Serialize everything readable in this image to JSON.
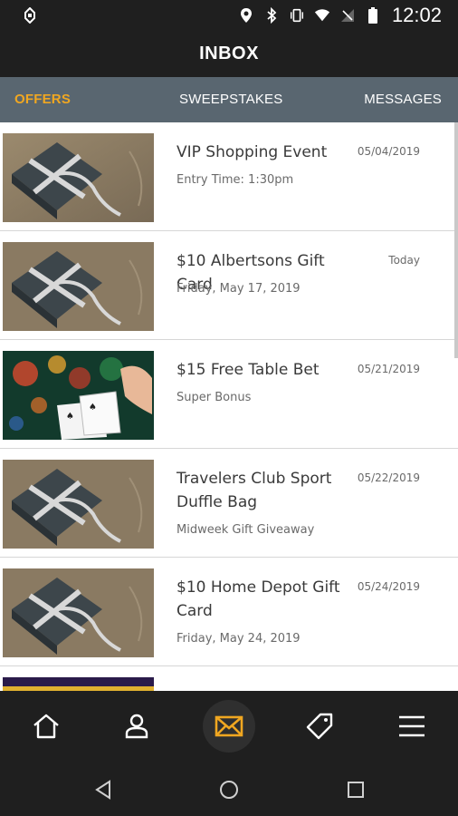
{
  "status_bar": {
    "time": "12:02",
    "icons": [
      "notification-icon",
      "location-icon",
      "bluetooth-icon",
      "vibrate-icon",
      "wifi-icon",
      "no-signal-icon",
      "battery-icon"
    ]
  },
  "header": {
    "title": "INBOX"
  },
  "tabs": [
    {
      "label": "OFFERS",
      "active": true
    },
    {
      "label": "SWEEPSTAKES",
      "active": false
    },
    {
      "label": "MESSAGES",
      "active": false
    }
  ],
  "items": [
    {
      "title": "VIP Shopping Event",
      "subtitle": "Entry Time: 1:30pm",
      "date": "05/04/2019",
      "image": "gift-box"
    },
    {
      "title": "$10 Albertsons Gift Card",
      "subtitle": "Friday, May 17, 2019",
      "date": "Today",
      "image": "gift-box"
    },
    {
      "title": "$15 Free Table Bet",
      "subtitle": "Super Bonus",
      "date": "05/21/2019",
      "image": "playing-cards"
    },
    {
      "title": "Travelers Club Sport Duffle Bag",
      "subtitle": "Midweek Gift Giveaway",
      "date": "05/22/2019",
      "image": "gift-box"
    },
    {
      "title": "$10 Home Depot Gift Card",
      "subtitle": "Friday, May 24, 2019",
      "date": "05/24/2019",
      "image": "gift-box"
    }
  ],
  "bottom_nav": [
    {
      "icon": "home-icon",
      "active": false
    },
    {
      "icon": "profile-icon",
      "active": false
    },
    {
      "icon": "mail-icon",
      "active": true
    },
    {
      "icon": "tag-icon",
      "active": false
    },
    {
      "icon": "menu-icon",
      "active": false
    }
  ],
  "system_nav": [
    "back-icon",
    "home-circle-icon",
    "recents-icon"
  ],
  "colors": {
    "accent": "#f0a721",
    "tab_bar": "#596670",
    "background_dark": "#1f1f1f"
  }
}
